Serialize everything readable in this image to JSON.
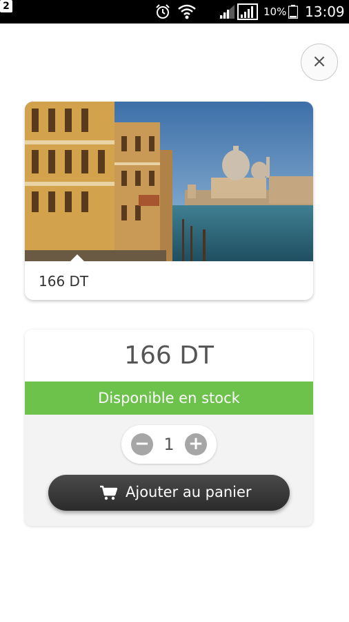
{
  "status_bar": {
    "sim_slot": "2",
    "battery_percent": "10%",
    "time": "13:09",
    "icons": [
      "alarm-icon",
      "wifi-icon",
      "signal-icon",
      "battery-icon"
    ]
  },
  "close_button": {
    "icon": "close-icon",
    "glyph": "×"
  },
  "product_card": {
    "image_subject": "venice-grand-canal",
    "caption": "166 DT"
  },
  "purchase": {
    "price": "166 DT",
    "stock_status": "Disponible en stock",
    "quantity": "1",
    "minus_glyph": "−",
    "plus_glyph": "+",
    "add_to_cart_label": "Ajouter au panier"
  },
  "colors": {
    "stock_green": "#6cc24a",
    "button_dark": "#333333",
    "stepper_gray": "#a6a6a6"
  }
}
